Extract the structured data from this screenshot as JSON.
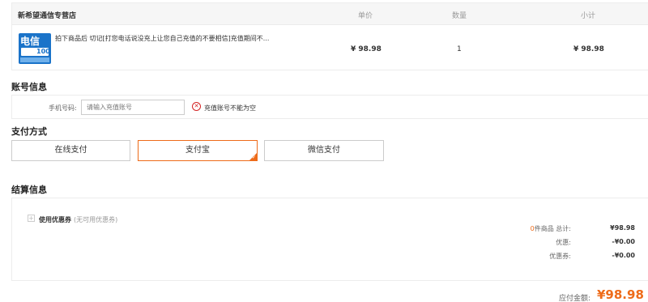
{
  "order": {
    "shop_name": "新希望通信专营店",
    "headers": {
      "price": "单价",
      "quantity": "数量",
      "subtotal": "小计"
    },
    "item": {
      "thumb_text_top": "电信",
      "thumb_text_amount": "100元",
      "title": "拍下商品后 切记[打您电话说没充上让您自己充值的不要相信]充值期间不...",
      "price": "¥ 98.98",
      "quantity": "1",
      "subtotal": "¥ 98.98"
    }
  },
  "account": {
    "section_title": "账号信息",
    "phone_label": "手机号码:",
    "phone_placeholder": "请输入充值账号",
    "error_text": "充值账号不能为空"
  },
  "payment": {
    "section_title": "支付方式",
    "options": [
      {
        "label": "在线支付",
        "selected": false
      },
      {
        "label": "支付宝",
        "selected": true
      },
      {
        "label": "微信支付",
        "selected": false
      }
    ],
    "accent_color": "#ee6b19"
  },
  "settlement": {
    "section_title": "结算信息",
    "coupon_label": "使用优惠券",
    "coupon_note": "(无可用优惠券)",
    "items_count": "0",
    "items_label": "件商品 总计:",
    "items_total": "¥98.98",
    "discount_label": "优惠:",
    "discount_value": "-¥0.00",
    "coupon_sum_label": "优惠券:",
    "coupon_sum_value": "-¥0.00"
  },
  "total": {
    "label": "应付金额:",
    "value": "¥98.98"
  }
}
